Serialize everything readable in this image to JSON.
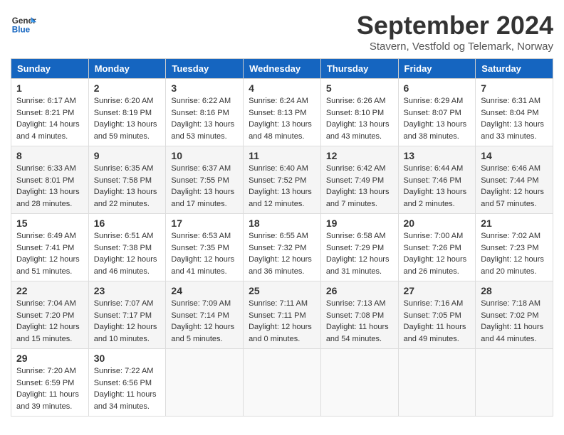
{
  "header": {
    "logo_general": "General",
    "logo_blue": "Blue",
    "month_title": "September 2024",
    "subtitle": "Stavern, Vestfold og Telemark, Norway"
  },
  "days_of_week": [
    "Sunday",
    "Monday",
    "Tuesday",
    "Wednesday",
    "Thursday",
    "Friday",
    "Saturday"
  ],
  "weeks": [
    [
      {
        "day": "1",
        "sunrise": "6:17 AM",
        "sunset": "8:21 PM",
        "daylight": "14 hours and 4 minutes."
      },
      {
        "day": "2",
        "sunrise": "6:20 AM",
        "sunset": "8:19 PM",
        "daylight": "13 hours and 59 minutes."
      },
      {
        "day": "3",
        "sunrise": "6:22 AM",
        "sunset": "8:16 PM",
        "daylight": "13 hours and 53 minutes."
      },
      {
        "day": "4",
        "sunrise": "6:24 AM",
        "sunset": "8:13 PM",
        "daylight": "13 hours and 48 minutes."
      },
      {
        "day": "5",
        "sunrise": "6:26 AM",
        "sunset": "8:10 PM",
        "daylight": "13 hours and 43 minutes."
      },
      {
        "day": "6",
        "sunrise": "6:29 AM",
        "sunset": "8:07 PM",
        "daylight": "13 hours and 38 minutes."
      },
      {
        "day": "7",
        "sunrise": "6:31 AM",
        "sunset": "8:04 PM",
        "daylight": "13 hours and 33 minutes."
      }
    ],
    [
      {
        "day": "8",
        "sunrise": "6:33 AM",
        "sunset": "8:01 PM",
        "daylight": "13 hours and 28 minutes."
      },
      {
        "day": "9",
        "sunrise": "6:35 AM",
        "sunset": "7:58 PM",
        "daylight": "13 hours and 22 minutes."
      },
      {
        "day": "10",
        "sunrise": "6:37 AM",
        "sunset": "7:55 PM",
        "daylight": "13 hours and 17 minutes."
      },
      {
        "day": "11",
        "sunrise": "6:40 AM",
        "sunset": "7:52 PM",
        "daylight": "13 hours and 12 minutes."
      },
      {
        "day": "12",
        "sunrise": "6:42 AM",
        "sunset": "7:49 PM",
        "daylight": "13 hours and 7 minutes."
      },
      {
        "day": "13",
        "sunrise": "6:44 AM",
        "sunset": "7:46 PM",
        "daylight": "13 hours and 2 minutes."
      },
      {
        "day": "14",
        "sunrise": "6:46 AM",
        "sunset": "7:44 PM",
        "daylight": "12 hours and 57 minutes."
      }
    ],
    [
      {
        "day": "15",
        "sunrise": "6:49 AM",
        "sunset": "7:41 PM",
        "daylight": "12 hours and 51 minutes."
      },
      {
        "day": "16",
        "sunrise": "6:51 AM",
        "sunset": "7:38 PM",
        "daylight": "12 hours and 46 minutes."
      },
      {
        "day": "17",
        "sunrise": "6:53 AM",
        "sunset": "7:35 PM",
        "daylight": "12 hours and 41 minutes."
      },
      {
        "day": "18",
        "sunrise": "6:55 AM",
        "sunset": "7:32 PM",
        "daylight": "12 hours and 36 minutes."
      },
      {
        "day": "19",
        "sunrise": "6:58 AM",
        "sunset": "7:29 PM",
        "daylight": "12 hours and 31 minutes."
      },
      {
        "day": "20",
        "sunrise": "7:00 AM",
        "sunset": "7:26 PM",
        "daylight": "12 hours and 26 minutes."
      },
      {
        "day": "21",
        "sunrise": "7:02 AM",
        "sunset": "7:23 PM",
        "daylight": "12 hours and 20 minutes."
      }
    ],
    [
      {
        "day": "22",
        "sunrise": "7:04 AM",
        "sunset": "7:20 PM",
        "daylight": "12 hours and 15 minutes."
      },
      {
        "day": "23",
        "sunrise": "7:07 AM",
        "sunset": "7:17 PM",
        "daylight": "12 hours and 10 minutes."
      },
      {
        "day": "24",
        "sunrise": "7:09 AM",
        "sunset": "7:14 PM",
        "daylight": "12 hours and 5 minutes."
      },
      {
        "day": "25",
        "sunrise": "7:11 AM",
        "sunset": "7:11 PM",
        "daylight": "12 hours and 0 minutes."
      },
      {
        "day": "26",
        "sunrise": "7:13 AM",
        "sunset": "7:08 PM",
        "daylight": "11 hours and 54 minutes."
      },
      {
        "day": "27",
        "sunrise": "7:16 AM",
        "sunset": "7:05 PM",
        "daylight": "11 hours and 49 minutes."
      },
      {
        "day": "28",
        "sunrise": "7:18 AM",
        "sunset": "7:02 PM",
        "daylight": "11 hours and 44 minutes."
      }
    ],
    [
      {
        "day": "29",
        "sunrise": "7:20 AM",
        "sunset": "6:59 PM",
        "daylight": "11 hours and 39 minutes."
      },
      {
        "day": "30",
        "sunrise": "7:22 AM",
        "sunset": "6:56 PM",
        "daylight": "11 hours and 34 minutes."
      },
      null,
      null,
      null,
      null,
      null
    ]
  ]
}
